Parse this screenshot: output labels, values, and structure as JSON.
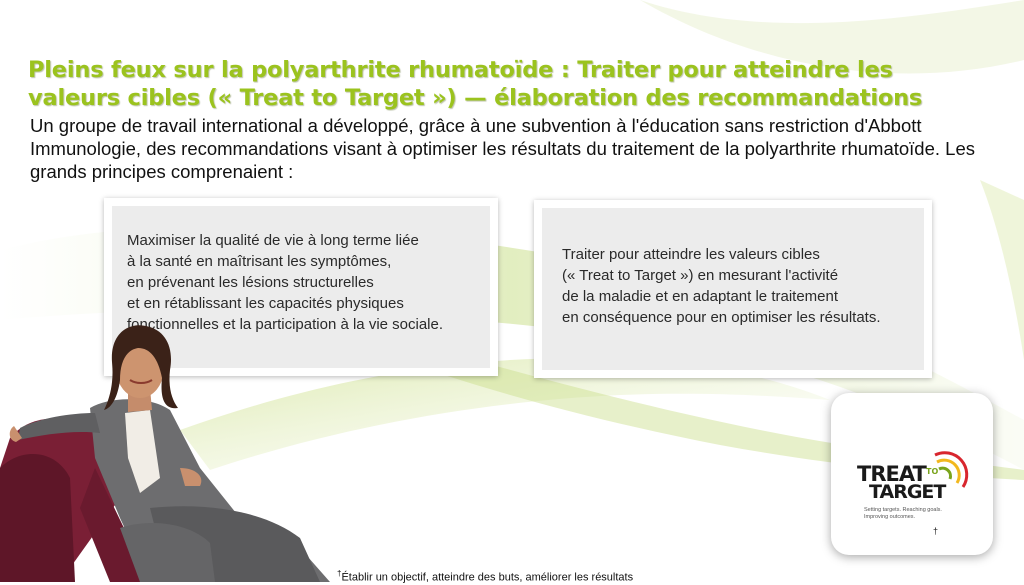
{
  "heading": {
    "title": "Pleins feux sur la polyarthrite rhumatoïde : Traiter pour atteindre les valeurs cibles (« Treat to Target ») — élaboration des recommandations",
    "intro": "Un groupe de travail international a développé, grâce à une subvention à l'éducation sans restriction d'Abbott Immunologie, des recommandations visant à optimiser les résultats du traitement de la polyarthrite rhumatoïde. Les grands principes comprenaient :"
  },
  "principles": [
    {
      "text": "Maximiser la qualité de vie à long terme liée\nà la santé en maîtrisant les symptômes,\nen prévenant les lésions structurelles\net en rétablissant les capacités physiques\nfonctionnelles et la participation à la vie sociale."
    },
    {
      "text": "Traiter pour atteindre les valeurs cibles\n(« Treat to Target ») en mesurant l'activité\nde la maladie et en adaptant le traitement\nen conséquence pour en optimiser les résultats."
    }
  ],
  "logo": {
    "word_treat": "TREAT",
    "word_to": "TO",
    "word_target": "TARGET",
    "tagline": "Setting targets. Reaching goals. Improving outcomes.",
    "dagger": "†",
    "icon": "target-arcs-icon"
  },
  "footnote": {
    "mark": "†",
    "text": "Établir un objectif, atteindre des buts, améliorer les résultats"
  },
  "colors": {
    "title_green": "#9bc31e",
    "swoosh_green": "#c9de8a",
    "arc_red": "#d8262e",
    "arc_yellow": "#f2b81e",
    "arc_green": "#7aa41c",
    "chair_maroon": "#7a1f35",
    "suit_gray": "#6d6d6f"
  }
}
